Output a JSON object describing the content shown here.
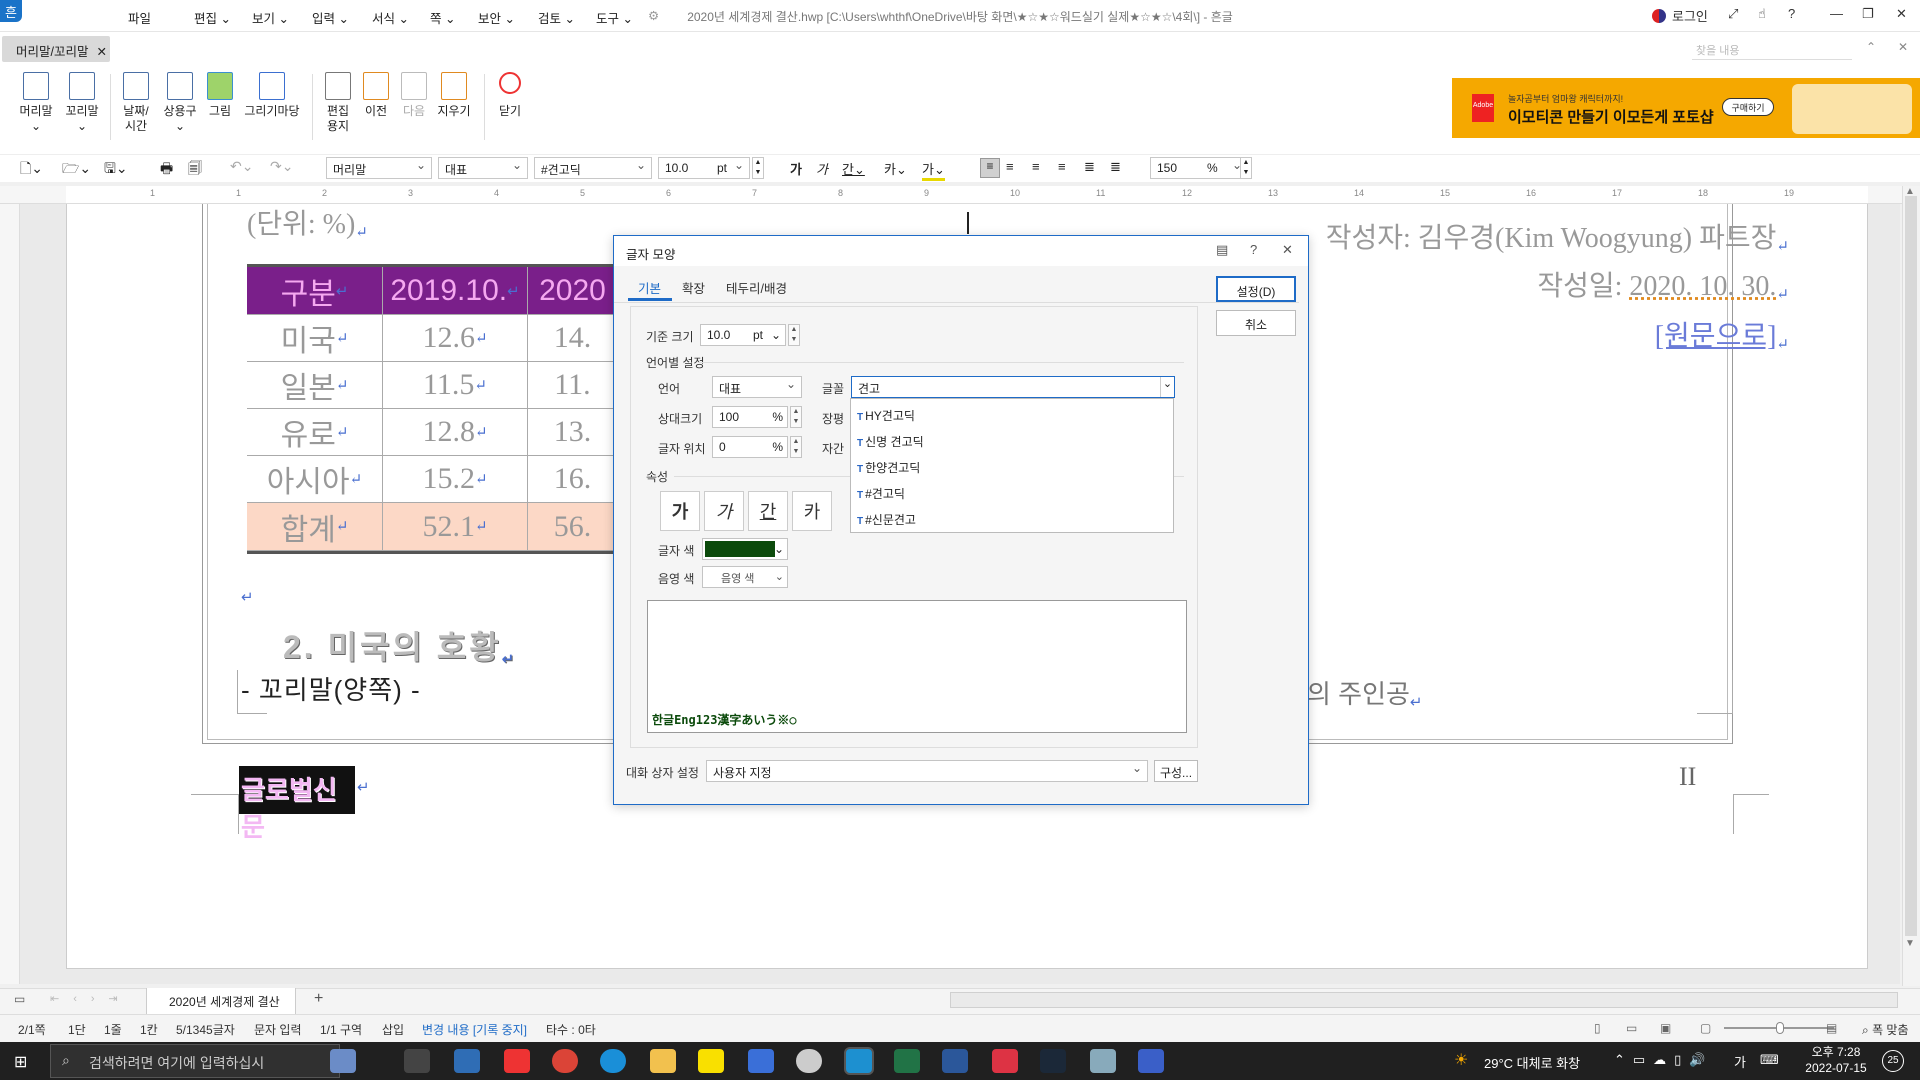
{
  "window": {
    "title": "2020년 세계경제 결산.hwp [C:\\Users\\whthf\\OneDrive\\바탕 화면\\★☆★☆워드실기 실제★☆★☆\\4회\\] - 흔글",
    "login": "로그인",
    "app_icon": "흔"
  },
  "menu": {
    "context_tab": "머리말/꼬리말",
    "items": [
      "파일",
      "편집",
      "보기",
      "입력",
      "서식",
      "쪽",
      "보안",
      "검토",
      "도구"
    ]
  },
  "ribbon": {
    "buttons": [
      {
        "label": "머리말",
        "icon": "header-icon"
      },
      {
        "label": "꼬리말",
        "icon": "footer-icon"
      },
      {
        "label": "날짜/\n시간",
        "icon": "datetime-icon"
      },
      {
        "label": "상용구",
        "icon": "autotext-icon"
      },
      {
        "label": "그림",
        "icon": "picture-icon"
      },
      {
        "label": "그리기마당",
        "icon": "drawing-icon"
      },
      {
        "label": "편집\n용지",
        "icon": "page-setup-icon"
      },
      {
        "label": "이전",
        "icon": "prev-icon"
      },
      {
        "label": "다음",
        "icon": "next-icon",
        "disabled": true
      },
      {
        "label": "지우기",
        "icon": "erase-icon"
      },
      {
        "label": "닫기",
        "icon": "close-circle-icon"
      }
    ],
    "search_placeholder": "찾을 내용"
  },
  "ad": {
    "brand": "Adobe",
    "line1": "놀자곰부터 엄마왕 캐릭터까지!",
    "line2": "이모티콘 만들기 이모든게 포토샵",
    "button": "구매하기"
  },
  "format_toolbar": {
    "style": "머리말",
    "lang": "대표",
    "font": "#견고딕",
    "size": "10.0",
    "size_unit": "pt",
    "zoom": "150",
    "zoom_unit": "%"
  },
  "ruler_numbers": [
    "1",
    "1",
    "2",
    "3",
    "4",
    "5",
    "6",
    "7",
    "8",
    "9",
    "10",
    "11",
    "12",
    "13",
    "14",
    "15",
    "16",
    "17",
    "18",
    "19"
  ],
  "document": {
    "unit_text": "(단위: %)",
    "author": "작성자: 김우경(Kim Woogyung) 파트장",
    "date_label": "작성일: ",
    "date_value": "2020. 10. 30.",
    "link": "[원문으로]",
    "table": {
      "headers": [
        "구분",
        "2019.10.",
        "2020"
      ],
      "rows": [
        [
          "미국",
          "12.6",
          "14."
        ],
        [
          "일본",
          "11.5",
          "11."
        ],
        [
          "유로",
          "12.8",
          "13."
        ],
        [
          "아시아",
          "15.2",
          "16."
        ]
      ],
      "total": [
        "합계",
        "52.1",
        "56."
      ]
    },
    "section_heading": "2. 미국의 호황",
    "footer_text": "- 꼬리말(양쪽) -",
    "footer_right": "의 주인공",
    "header_box": "글로벌신문",
    "page_mark": "II"
  },
  "dialog": {
    "title": "글자 모양",
    "tabs": [
      "기본",
      "확장",
      "테두리/배경"
    ],
    "base_size_label": "기준 크기",
    "base_size": "10.0",
    "base_unit": "pt",
    "lang_section": "언어별 설정",
    "lang_label": "언어",
    "lang_value": "대표",
    "font_label": "글꼴",
    "font_value": "견고",
    "rel_size_label": "상대크기",
    "rel_size": "100",
    "percent": "%",
    "width_label": "장평",
    "pos_label": "글자 위치",
    "pos_value": "0",
    "spacing_label": "자간",
    "attr_section": "속성",
    "attr_buttons": [
      "가",
      "가",
      "간",
      "카"
    ],
    "text_color_label": "글자 색",
    "text_color": "#0b4a0b",
    "shade_label": "음영 색",
    "shade_value": "음영 색",
    "font_options": [
      "HY견고딕",
      "신명 견고딕",
      "한양견고딕",
      "#견고딕",
      "#신문견고"
    ],
    "preview_text": "한글Eng123漢字あいう※○",
    "ok": "설정(D)",
    "cancel": "취소",
    "box_label": "대화 상자 설정",
    "box_value": "사용자 지정",
    "config": "구성..."
  },
  "doc_tab": "2020년 세계경제 결산",
  "status": [
    "2/1쪽",
    "1단",
    "1줄",
    "1칸",
    "5/1345글자",
    "문자 입력",
    "1/1 구역",
    "삽입",
    "변경 내용 [기록 중지]",
    "타수 : 0타"
  ],
  "status_zoom": "폭 맞춤",
  "taskbar": {
    "search": "검색하려면 여기에 입력하십시",
    "weather": "29°C  대체로 화창",
    "time": "오후 7:28",
    "date": "2022-07-15",
    "lang": "가",
    "notif": "25"
  }
}
